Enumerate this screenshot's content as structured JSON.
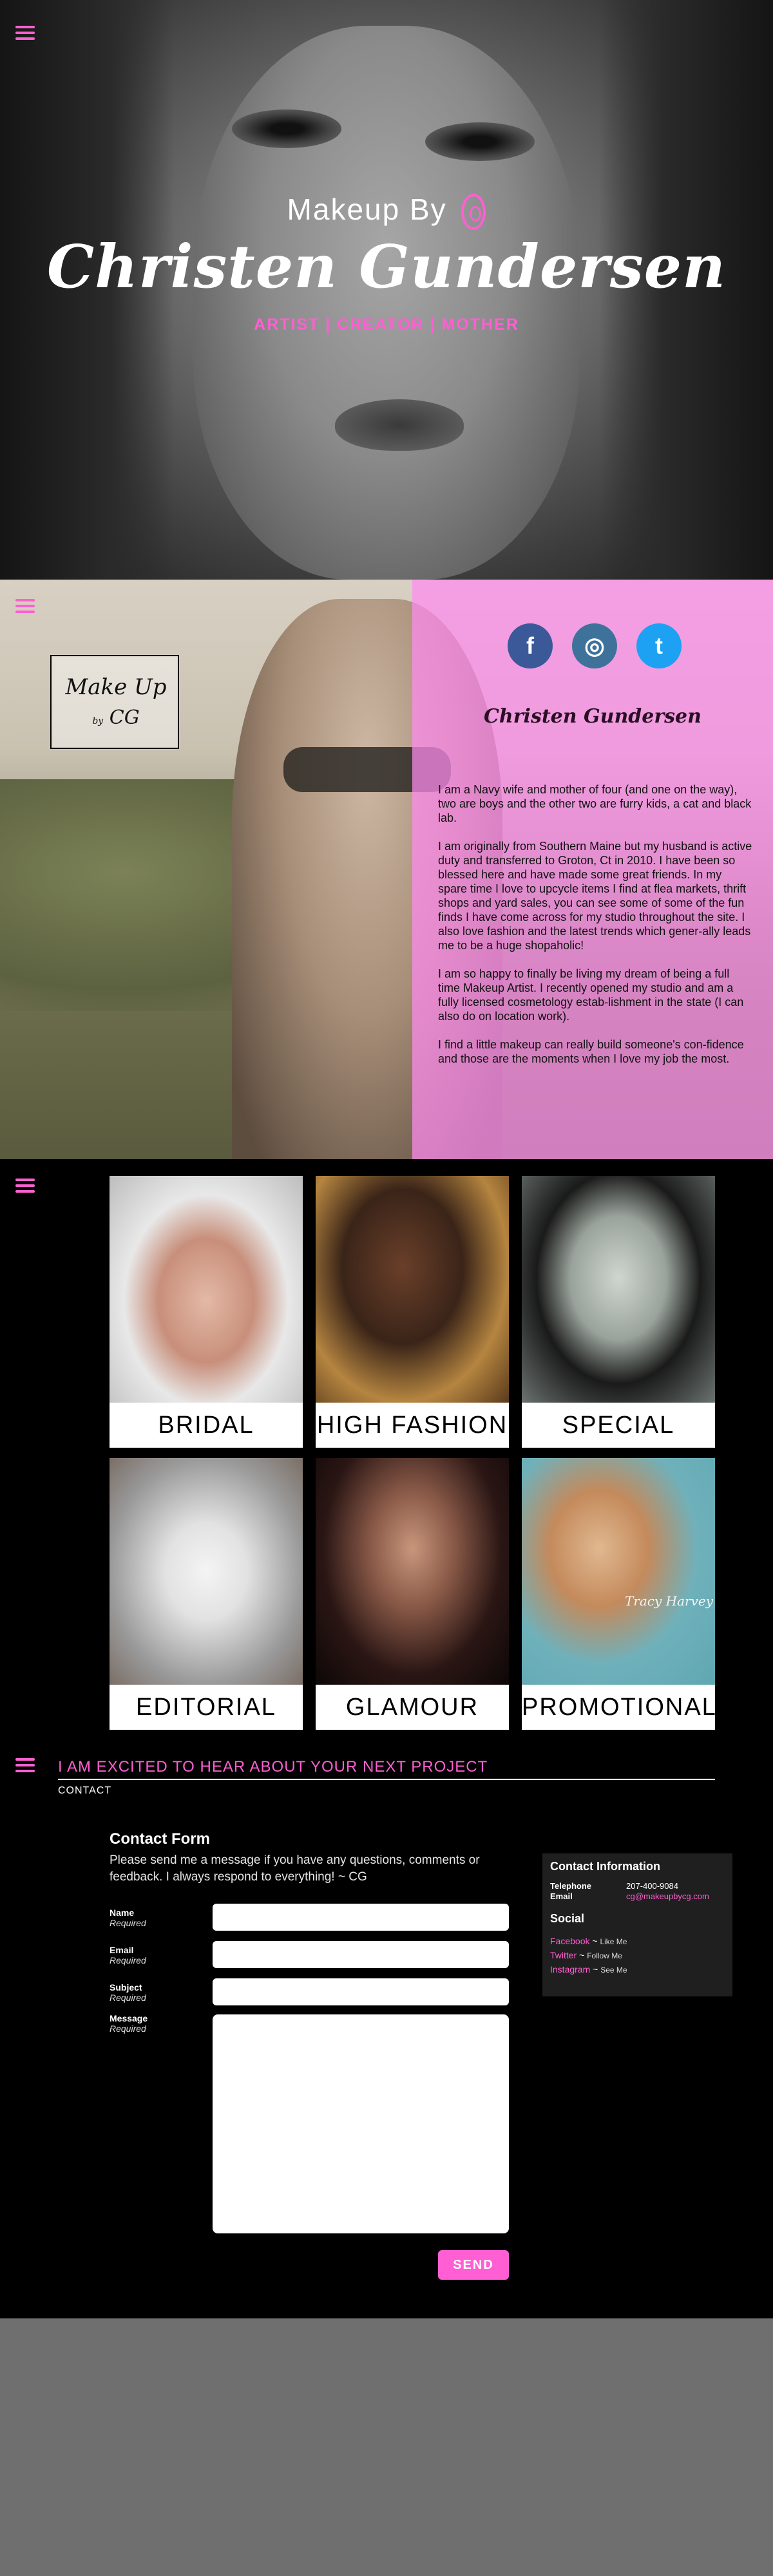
{
  "hero": {
    "title_small": "Makeup By",
    "title_script": "Christen Gundersen",
    "tagline": "ARTIST | CREATOR | MOTHER"
  },
  "about": {
    "logo_text": "Make Up",
    "logo_by": "by",
    "logo_initials": "CG",
    "name": "Christen Gundersen",
    "social": [
      "f",
      "◎",
      "t"
    ],
    "bio": [
      "I am a Navy wife and mother of four (and one on the way), two are boys and the other two are furry kids, a cat and black lab.",
      "I am originally from Southern Maine but my husband is active duty and transferred to Groton, Ct in 2010. I have been so blessed here and have made some great friends. In my spare time I love to upcycle items I find at flea markets, thrift shops and yard sales, you can see some of some of the fun finds I have come across for my studio throughout the site. I also love fashion and the latest trends which gener-ally leads me to be a huge shopaholic!",
      "I am so happy to finally be living my dream of being a full time Makeup Artist. I recently opened my studio and am a fully licensed cosmetology estab-lishment in the state (I can also do on location work).",
      "I find a little makeup can really build someone's con-fidence and those are the moments when I love my job the most."
    ]
  },
  "gallery": {
    "tiles": [
      {
        "label": "BRIDAL"
      },
      {
        "label": "HIGH FASHION"
      },
      {
        "label": "SPECIAL"
      },
      {
        "label": "EDITORIAL"
      },
      {
        "label": "GLAMOUR"
      },
      {
        "label": "PROMOTIONAL"
      }
    ],
    "watermark": "Tracy Harvey"
  },
  "contact": {
    "heading": "I AM EXCITED TO HEAR ABOUT YOUR NEXT PROJECT",
    "sub": "CONTACT",
    "form_title": "Contact Form",
    "form_intro": "Please send me a message if you have any questions, comments or feedback. I always respond to everything! ~ CG",
    "fields": [
      {
        "label": "Name",
        "note": "Required"
      },
      {
        "label": "Email",
        "note": "Required"
      },
      {
        "label": "Subject",
        "note": "Required"
      },
      {
        "label": "Message",
        "note": "Required"
      }
    ],
    "send_label": "SEND",
    "info": {
      "title": "Contact Information",
      "telephone_label": "Telephone",
      "telephone": "207-400-9084",
      "email_label": "Email",
      "email": "cg@makeupbycg.com",
      "social_title": "Social",
      "social": [
        {
          "name": "Facebook",
          "sep": " ~ ",
          "action": "Like Me"
        },
        {
          "name": "Twitter",
          "sep": " ~ ",
          "action": "Follow Me"
        },
        {
          "name": "Instagram",
          "sep": " ~ ",
          "action": "See Me"
        }
      ]
    }
  },
  "colors": {
    "accent": "#ff5fd2",
    "overlay": "#ff8cf0"
  }
}
